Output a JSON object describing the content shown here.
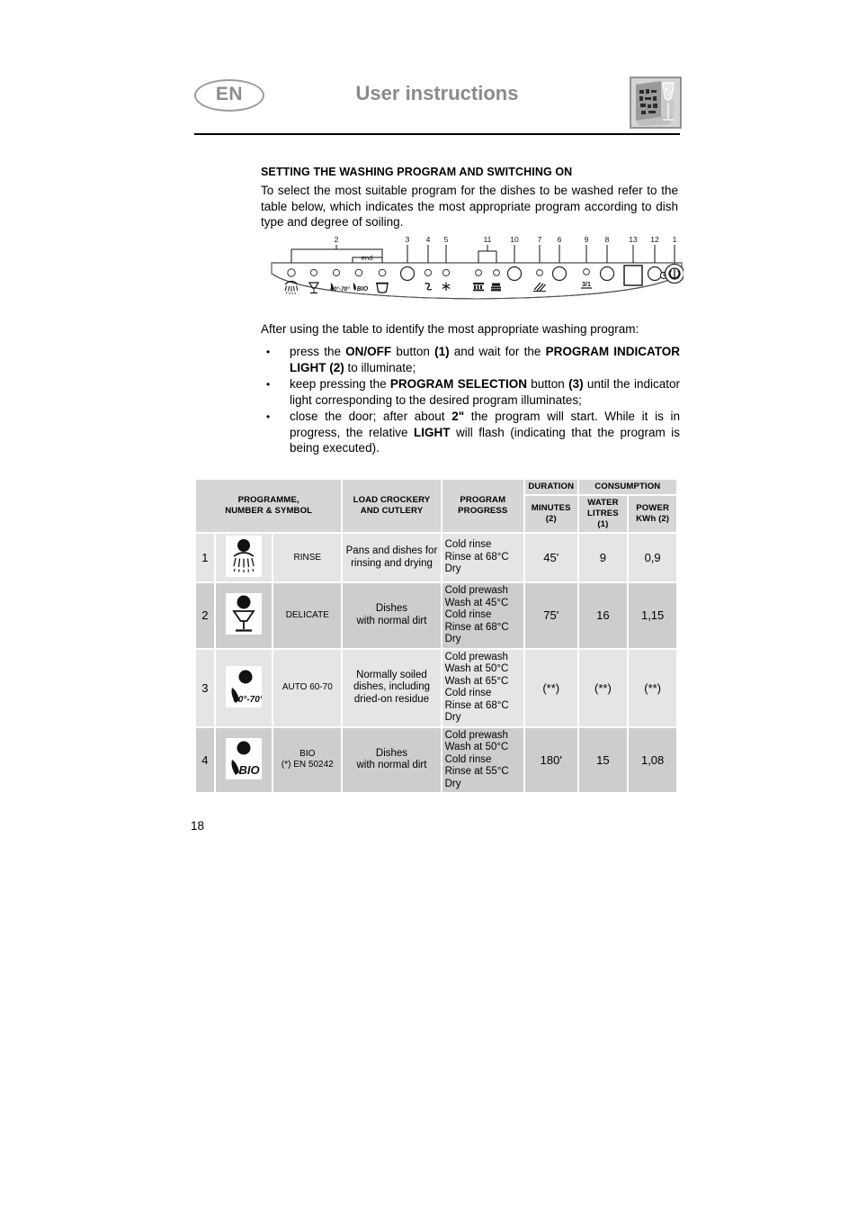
{
  "header": {
    "language_badge": "EN",
    "title": "User instructions",
    "logo_alt": "dishwasher-interior-with-glass"
  },
  "section": {
    "title": "SETTING THE WASHING PROGRAM AND SWITCHING ON",
    "intro": "To select the most suitable program for the dishes to be washed refer to the table below, which indicates the most appropriate program according to dish type and degree of soiling.",
    "after_table_line": "After using the table to identify the most appropriate washing program:"
  },
  "control_panel": {
    "end_label": "end",
    "callouts": [
      "2",
      "3",
      "4",
      "5",
      "11",
      "10",
      "7",
      "6",
      "9",
      "8",
      "13",
      "12",
      "1"
    ],
    "indicator_symbols": [
      "spray-rinse-icon",
      "glass-delicate-icon",
      "auto-60-70-icon",
      "bio-icon",
      "pot-icon"
    ],
    "option_symbols": [
      "salt-icon",
      "rinse-aid-star-icon",
      "half-load-upper-icon",
      "half-load-lower-icon",
      "scratch-icon",
      "3in1-icon"
    ],
    "half_load_label": "3/1",
    "power_symbol": "power-on-off-icon",
    "delay_symbol": "clock-delay-icon"
  },
  "bullets": [
    {
      "marker": "•",
      "segments": [
        {
          "text": "press the ",
          "bold": false
        },
        {
          "text": "ON/OFF",
          "bold": true
        },
        {
          "text": " button ",
          "bold": false
        },
        {
          "text": "(1)",
          "bold": true
        },
        {
          "text": " and wait for the ",
          "bold": false
        },
        {
          "text": "PROGRAM INDICATOR LIGHT (2)",
          "bold": true
        },
        {
          "text": " to illuminate;",
          "bold": false
        }
      ]
    },
    {
      "marker": "•",
      "segments": [
        {
          "text": "keep pressing the ",
          "bold": false
        },
        {
          "text": "PROGRAM SELECTION",
          "bold": true
        },
        {
          "text": " button ",
          "bold": false
        },
        {
          "text": "(3)",
          "bold": true
        },
        {
          "text": " until the indicator light corresponding to the desired program illuminates;",
          "bold": false
        }
      ]
    },
    {
      "marker": "•",
      "segments": [
        {
          "text": "close the door; after about ",
          "bold": false
        },
        {
          "text": "2\"",
          "bold": true
        },
        {
          "text": " the program will start. While it is in progress, the relative ",
          "bold": false
        },
        {
          "text": "LIGHT",
          "bold": true
        },
        {
          "text": " will flash (indicating that the program is being executed).",
          "bold": false
        }
      ]
    }
  ],
  "table": {
    "group_headers": {
      "programme": "PROGRAMME,\nNUMBER & SYMBOL",
      "programme_line1": "PROGRAMME,",
      "programme_line2": "NUMBER & SYMBOL",
      "load_line1": "LOAD CROCKERY",
      "load_line2": "AND CUTLERY",
      "progress_line1": "PROGRAM",
      "progress_line2": "PROGRESS",
      "duration": "DURATION",
      "consumption": "CONSUMPTION"
    },
    "sub_headers": {
      "minutes_line1": "MINUTES",
      "minutes_line2": "(2)",
      "water_line1": "WATER",
      "water_line2": "LITRES (1)",
      "power_line1": "POWER",
      "power_line2": "KWh (2)"
    },
    "rows": [
      {
        "number": "1",
        "symbol": "spray-rinse-icon",
        "name": "RINSE",
        "name_sub": "",
        "load": "Pans and dishes for rinsing and drying",
        "load_line1": "Pans and dishes for",
        "load_line2": "rinsing and drying",
        "progress": [
          "Cold rinse",
          "Rinse at 68°C",
          "Dry"
        ],
        "minutes": "45'",
        "water": "9",
        "power": "0,9",
        "shade": "light"
      },
      {
        "number": "2",
        "symbol": "glass-delicate-icon",
        "name": "DELICATE",
        "name_sub": "",
        "load": "Dishes with normal dirt",
        "load_line1": "Dishes",
        "load_line2": "with normal dirt",
        "progress": [
          "Cold prewash",
          "Wash at 45°C",
          "Cold rinse",
          "Rinse at 68°C",
          "Dry"
        ],
        "minutes": "75'",
        "water": "16",
        "power": "1,15",
        "shade": "dark"
      },
      {
        "number": "3",
        "symbol": "auto-60-70-icon",
        "name": "AUTO 60-70",
        "name_sub": "",
        "load": "Normally soiled dishes, including dried-on residue",
        "load_line1": "Normally soiled",
        "load_line2": "dishes, including",
        "load_line3": "dried-on residue",
        "progress": [
          "Cold prewash",
          "Wash at 50°C",
          "Wash at 65°C",
          "Cold rinse",
          "Rinse at 68°C",
          "Dry"
        ],
        "minutes": "(**)",
        "water": "(**)",
        "power": "(**)",
        "shade": "light"
      },
      {
        "number": "4",
        "symbol": "bio-icon",
        "name": "BIO",
        "name_sub": "(*) EN 50242",
        "load": "Dishes with normal dirt",
        "load_line1": "Dishes",
        "load_line2": "with normal dirt",
        "progress": [
          "Cold prewash",
          "Wash at 50°C",
          "Cold rinse",
          "Rinse at 55°C",
          "Dry"
        ],
        "minutes": "180'",
        "water": "15",
        "power": "1,08",
        "shade": "dark"
      }
    ]
  },
  "footer": {
    "page_number": "18"
  },
  "colors": {
    "header_gray": "#8a8a8a",
    "table_header_bg": "#d6d6d6",
    "row_light_bg": "#e5e5e5",
    "row_dark_bg": "#cdcdcd",
    "text": "#000000"
  }
}
